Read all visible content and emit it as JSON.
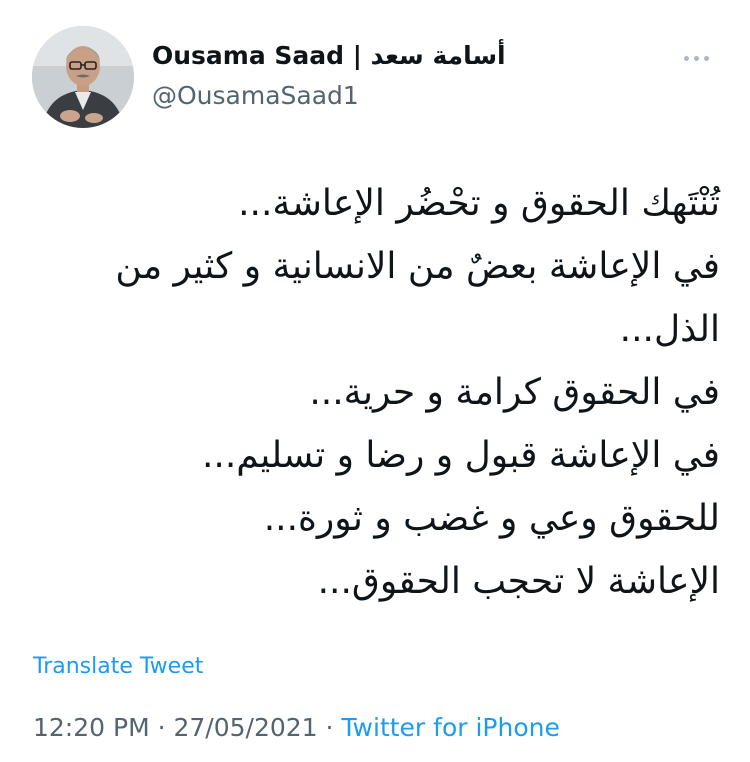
{
  "author": {
    "display_name": "Ousama Saad | أسامة سعد",
    "handle": "@OusamaSaad1"
  },
  "tweet": {
    "lines": [
      "تُنْتَهك الحقوق و تحْضُر الإعاشة...",
      "في الإعاشة بعضٌ من الانسانية و كثير من",
      "الذل...",
      "في الحقوق كرامة و حرية...",
      "في الإعاشة قبول و رضا و تسليم...",
      "للحقوق وعي و غضب و ثورة...",
      "الإعاشة لا تحجب الحقوق..."
    ]
  },
  "actions": {
    "translate_label": "Translate Tweet",
    "more_icon": "more-horizontal-icon"
  },
  "meta": {
    "time": "12:20 PM",
    "separator": " · ",
    "date": "27/05/2021",
    "source": "Twitter for iPhone"
  },
  "colors": {
    "link": "#1d9bf0",
    "secondary_text": "#536471",
    "primary_text": "#0f1419"
  }
}
